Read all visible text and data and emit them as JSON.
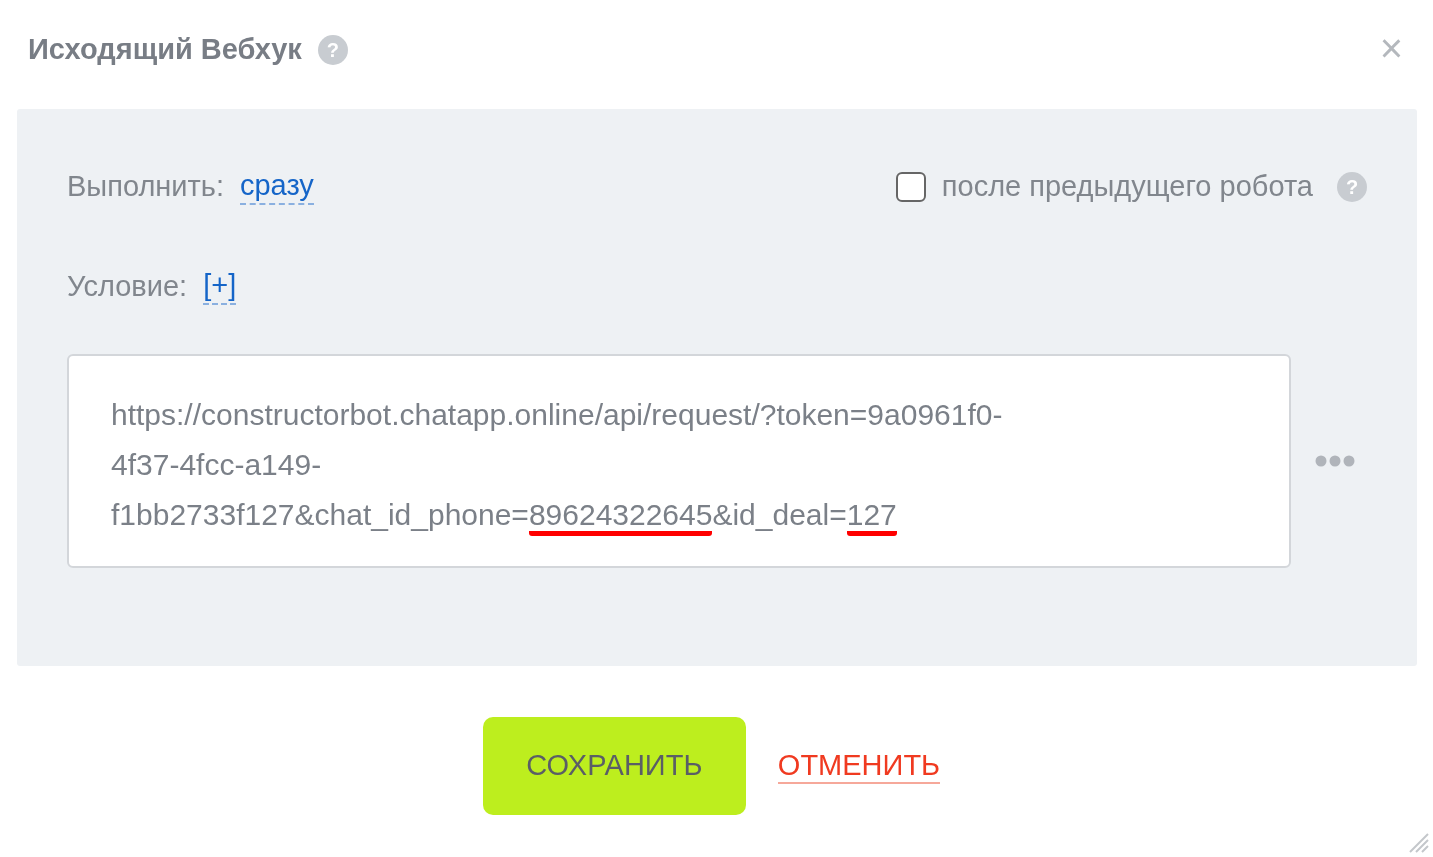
{
  "dialog": {
    "title": "Исходящий Вебхук",
    "help": "?",
    "close": "×"
  },
  "execute": {
    "label": "Выполнить:",
    "value": "сразу"
  },
  "after_previous": {
    "label": "после предыдущего робота",
    "checked": false,
    "help": "?"
  },
  "condition": {
    "label": "Условие:",
    "value": "[+]"
  },
  "url_field": {
    "lines": [
      [
        {
          "text": "https://constructorbot.chatapp.online/api/request/?token=9a0961f0-",
          "highlighted": false
        }
      ],
      [
        {
          "text": "4f37-4fcc-a149-",
          "highlighted": false
        }
      ],
      [
        {
          "text": "f1bb2733f127&chat_id_phone=",
          "highlighted": false
        },
        {
          "text": "89624322645",
          "highlighted": true
        },
        {
          "text": "&id_deal=",
          "highlighted": false
        },
        {
          "text": "127",
          "highlighted": true
        }
      ]
    ]
  },
  "buttons": [
    {
      "label": "СОХРАНИТЬ",
      "kind": "primary"
    },
    {
      "label": "ОТМЕНИТЬ",
      "kind": "link"
    }
  ]
}
